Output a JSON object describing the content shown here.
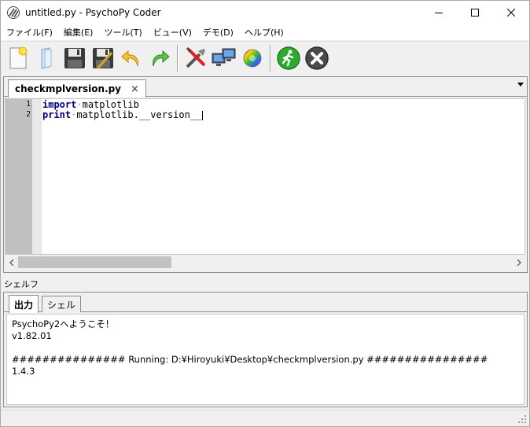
{
  "window": {
    "title": "untitled.py - PsychoPy Coder",
    "controls": [
      "minimize",
      "maximize",
      "close"
    ]
  },
  "menubar": {
    "items": [
      {
        "label": "ファイル(F)"
      },
      {
        "label": "編集(E)"
      },
      {
        "label": "ツール(T)"
      },
      {
        "label": "ビュー(V)"
      },
      {
        "label": "デモ(D)"
      },
      {
        "label": "ヘルプ(H)"
      }
    ]
  },
  "toolbar": {
    "icons": [
      "new-file-icon",
      "open-file-icon",
      "save-icon",
      "save-as-icon",
      "undo-icon",
      "redo-icon",
      "preferences-icon",
      "monitor-center-icon",
      "color-picker-icon",
      "run-icon",
      "stop-icon"
    ],
    "colors": {
      "run": "#2eaa2e",
      "stop": "#4a4a4a",
      "undo": "#e8b020",
      "redo": "#3cb03c"
    }
  },
  "editor": {
    "tab_label": "checkmplversion.py",
    "tab_close": "×",
    "lines": [
      {
        "num": "1",
        "keyword": "import",
        "rest": "matplotlib"
      },
      {
        "num": "2",
        "keyword": "print",
        "rest": "matplotlib.__version__"
      }
    ]
  },
  "shelf": {
    "label": "シェルフ",
    "tabs": [
      {
        "label": "出力",
        "active": true
      },
      {
        "label": "シェル",
        "active": false
      }
    ],
    "output_lines": [
      "PsychoPy2へようこそ！",
      "v1.82.01",
      "",
      "############### Running: D:¥Hiroyuki¥Desktop¥checkmplversion.py ################",
      "1.4.3"
    ]
  }
}
